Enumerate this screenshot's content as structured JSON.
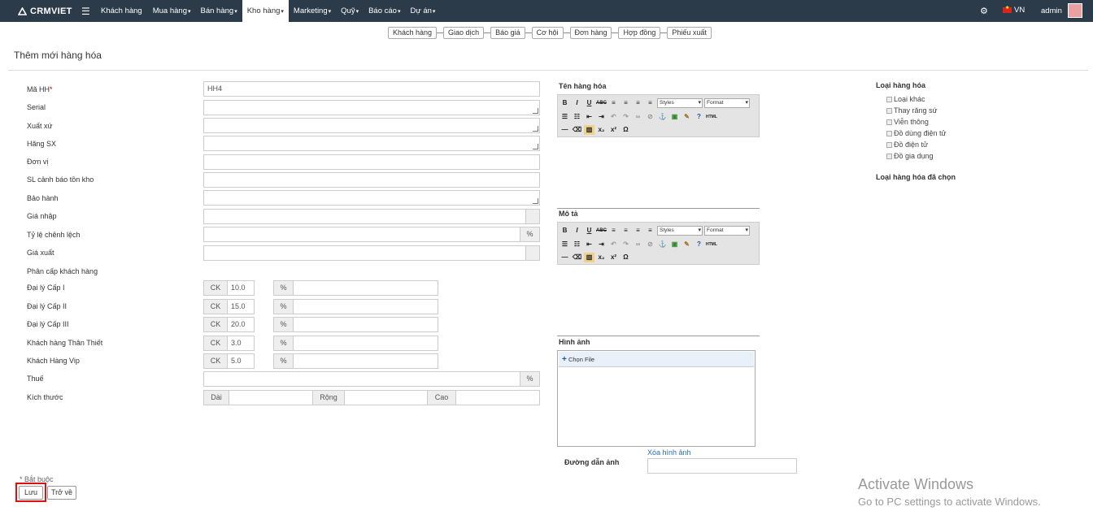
{
  "brand": "CRMVIET",
  "nav": [
    {
      "label": "Khách hàng",
      "caret": ""
    },
    {
      "label": "Mua hàng",
      "caret": "▾"
    },
    {
      "label": "Bán hàng",
      "caret": "▾"
    },
    {
      "label": "Kho hàng",
      "caret": "▾",
      "active": true
    },
    {
      "label": "Marketing",
      "caret": "▾"
    },
    {
      "label": "Quỹ",
      "caret": "▾"
    },
    {
      "label": "Báo cáo",
      "caret": "▾"
    },
    {
      "label": "Dự án",
      "caret": "▾"
    }
  ],
  "header_right": {
    "lang": "VN",
    "user": "admin"
  },
  "subtabs": [
    "Khách hàng",
    "Giao dịch",
    "Báo giá",
    "Cơ hội",
    "Đơn hàng",
    "Hợp đồng",
    "Phiếu xuất"
  ],
  "page_title": "Thêm mới hàng hóa",
  "form": {
    "code_label": "Mã HH",
    "code_required": "*",
    "code_value": "HH4",
    "serial_label": "Serial",
    "origin_label": "Xuất xứ",
    "manufacturer_label": "Hãng SX",
    "unit_label": "Đơn vị",
    "stock_warn_label": "SL cảnh báo tồn kho",
    "warranty_label": "Bảo hành",
    "import_price_label": "Giá nhập",
    "margin_label": "Tỷ lệ chênh lệch",
    "margin_addon": "%",
    "export_price_label": "Giá xuất",
    "tier_label": "Phân cấp khách hàng",
    "tiers": [
      {
        "label": "Đại lý Cấp I",
        "ck": "CK",
        "value": "10.0",
        "pct": "%"
      },
      {
        "label": "Đại lý Cấp II",
        "ck": "CK",
        "value": "15.0",
        "pct": "%"
      },
      {
        "label": "Đại lý Cấp III",
        "ck": "CK",
        "value": "20.0",
        "pct": "%"
      },
      {
        "label": "Khách hàng Thân Thiết",
        "ck": "CK",
        "value": "3.0",
        "pct": "%"
      },
      {
        "label": "Khách Hàng Vip",
        "ck": "CK",
        "value": "5.0",
        "pct": "%"
      }
    ],
    "tax_label": "Thuế",
    "tax_addon": "%",
    "size_label": "Kích thước",
    "dai": "Dài",
    "rong": "Rộng",
    "cao": "Cao"
  },
  "right": {
    "name_label": "Tên hàng hóa",
    "desc_label": "Mô tả",
    "image_label": "Hình ảnh",
    "choose_file": "Chọn File",
    "delete_image": "Xóa hình ảnh",
    "image_path_label": "Đường dẫn ảnh",
    "editor_styles": "Styles",
    "editor_format": "Format"
  },
  "category": {
    "title": "Loại hàng hóa",
    "items": [
      "Loại khác",
      "Thay răng sứ",
      "Viễn thông",
      "Đồ dùng điện tử",
      "Đồ điện tử",
      "Đồ gia dụng"
    ],
    "selected_title": "Loại hàng hóa đã chọn"
  },
  "footer": {
    "required_note": "* Bắt buộc",
    "save": "Lưu",
    "back": "Trở về"
  },
  "watermark": {
    "line1": "Activate Windows",
    "line2": "Go to PC settings to activate Windows."
  }
}
